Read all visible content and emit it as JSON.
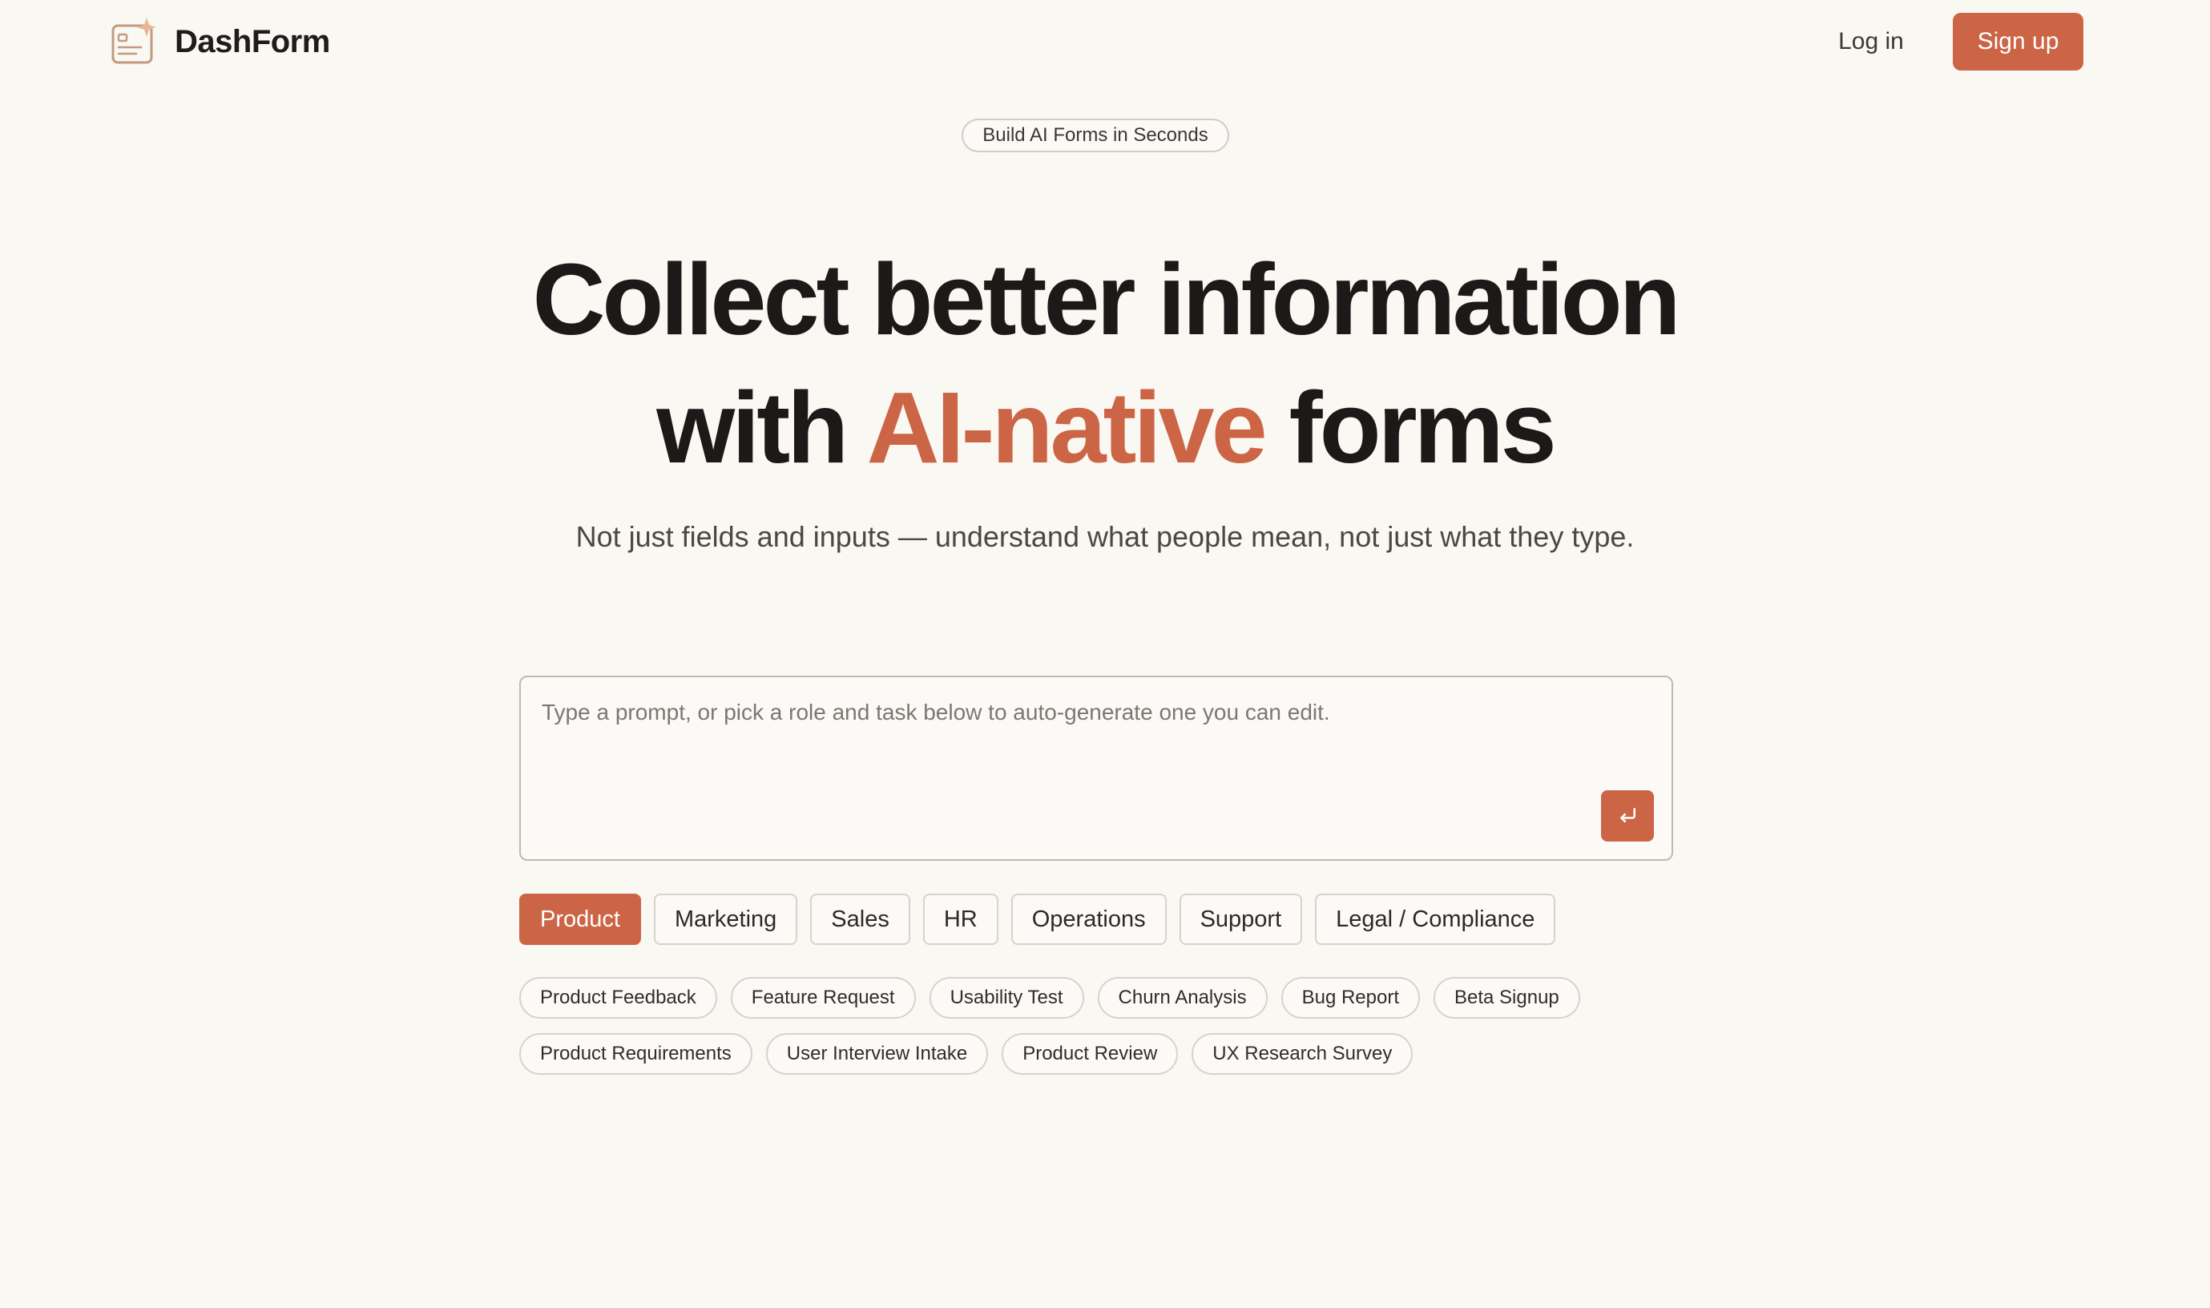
{
  "brand": {
    "name": "DashForm",
    "accent_color": "#cc6546",
    "logo_icon": "form-sparkle-icon"
  },
  "nav": {
    "login_label": "Log in",
    "signup_label": "Sign up"
  },
  "hero": {
    "badge": "Build AI Forms in Seconds",
    "headline_line1": "Collect better information",
    "headline_line2_prefix": "with ",
    "headline_line2_accent": "AI-native",
    "headline_line2_suffix": " forms",
    "subheadline": "Not just fields and inputs — understand what people mean, not just what they type."
  },
  "prompt": {
    "value": "",
    "placeholder": "Type a prompt, or pick a role and task below to auto-generate one you can edit.",
    "submit_icon": "enter-arrow-icon"
  },
  "roles": {
    "selected": "Product",
    "items": [
      "Product",
      "Marketing",
      "Sales",
      "HR",
      "Operations",
      "Support",
      "Legal / Compliance"
    ]
  },
  "tasks": {
    "items": [
      "Product Feedback",
      "Feature Request",
      "Usability Test",
      "Churn Analysis",
      "Bug Report",
      "Beta Signup",
      "Product Requirements",
      "User Interview Intake",
      "Product Review",
      "UX Research Survey"
    ]
  }
}
